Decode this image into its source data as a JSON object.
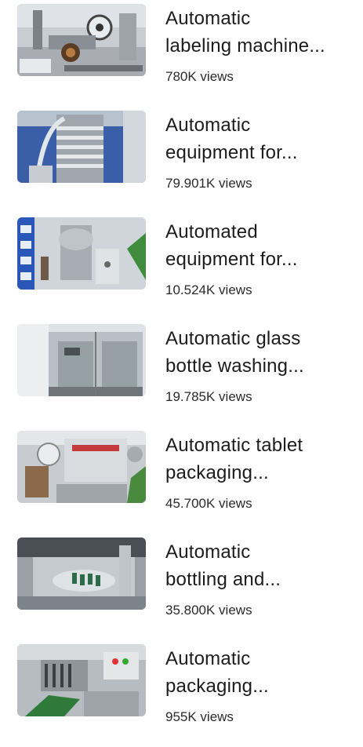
{
  "videos": [
    {
      "title_line1": "Automatic",
      "title_line2": "labeling machine...",
      "views": "780K views",
      "thumbnail": "labeling-machine"
    },
    {
      "title_line1": "Automatic",
      "title_line2": "equipment for...",
      "views": "79.901K views",
      "thumbnail": "coil-equipment"
    },
    {
      "title_line1": "Automated",
      "title_line2": "equipment for...",
      "views": "10.524K views",
      "thumbnail": "exhibition-booth"
    },
    {
      "title_line1": "Automatic glass",
      "title_line2": "bottle washing...",
      "views": "19.785K views",
      "thumbnail": "washing-cabinet"
    },
    {
      "title_line1": "Automatic tablet",
      "title_line2": "packaging...",
      "views": "45.700K views",
      "thumbnail": "tablet-packaging"
    },
    {
      "title_line1": "Automatic",
      "title_line2": "bottling and...",
      "views": "35.800K views",
      "thumbnail": "bottling-line"
    },
    {
      "title_line1": "Automatic",
      "title_line2": "packaging...",
      "views": "955K views",
      "thumbnail": "packaging-machine"
    }
  ],
  "colors": {
    "title": "#1c1c1c",
    "views": "#2a2a2a",
    "background": "#ffffff"
  }
}
